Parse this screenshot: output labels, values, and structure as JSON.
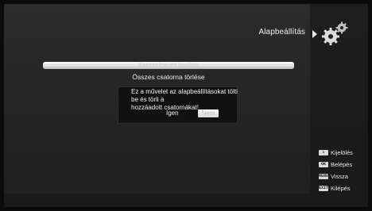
{
  "header": {
    "menu_title": "Alapbeállítás",
    "icon": "gears-icon"
  },
  "list": {
    "items": [
      {
        "label": "Alapértelmezett beállítás",
        "selected": true
      },
      {
        "label": "Összes csatorna törlése",
        "selected": false
      }
    ]
  },
  "dialog": {
    "message_line1": "Ez a művelet az alapbeállításokat tölti be és törli a",
    "message_line2": "hozzáadott csatornákat!",
    "yes_label": "Igen",
    "no_label": "Nem",
    "focused": "no"
  },
  "help": [
    {
      "key": "⇕",
      "label": "Kijelölés"
    },
    {
      "key": "OK",
      "label": "Belépés"
    },
    {
      "key": "MENU",
      "label": "Vissza"
    },
    {
      "key": "EXIT",
      "label": "Kilépés"
    }
  ],
  "colors": {
    "background": "#262626",
    "highlight": "#ffffff",
    "dialog": "#111111"
  }
}
